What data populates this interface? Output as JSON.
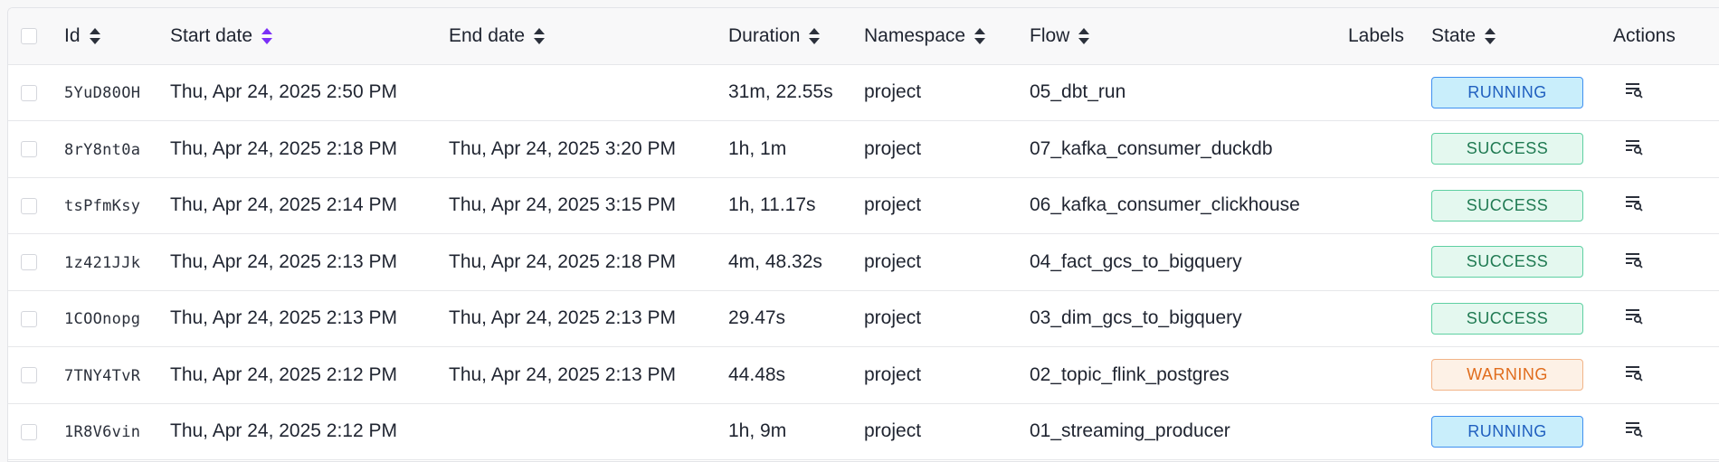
{
  "columns": {
    "id": "Id",
    "start_date": "Start date",
    "end_date": "End date",
    "duration": "Duration",
    "namespace": "Namespace",
    "flow": "Flow",
    "labels": "Labels",
    "state": "State",
    "actions": "Actions"
  },
  "sort": {
    "active_column": "start_date",
    "active_color": "#7b2ff7",
    "inactive_color": "#2b303b"
  },
  "state_colors": {
    "RUNNING": {
      "bg": "#c9eefb",
      "border": "#3f8ff0",
      "text": "#1f5fbf"
    },
    "SUCCESS": {
      "bg": "#e4f8ef",
      "border": "#5fd0a2",
      "text": "#1f7a52"
    },
    "WARNING": {
      "bg": "#fdf1e6",
      "border": "#f2b488",
      "text": "#e06c1c"
    }
  },
  "rows": [
    {
      "id": "5YuD80OH",
      "start": "Thu, Apr 24, 2025 2:50 PM",
      "end": "",
      "duration": "31m, 22.55s",
      "namespace": "project",
      "flow": "05_dbt_run",
      "labels": "",
      "state": "RUNNING",
      "action_icon": "logs-icon"
    },
    {
      "id": "8rY8nt0a",
      "start": "Thu, Apr 24, 2025 2:18 PM",
      "end": "Thu, Apr 24, 2025 3:20 PM",
      "duration": "1h, 1m",
      "namespace": "project",
      "flow": "07_kafka_consumer_duckdb",
      "labels": "",
      "state": "SUCCESS",
      "action_icon": "logs-icon"
    },
    {
      "id": "tsPfmKsy",
      "start": "Thu, Apr 24, 2025 2:14 PM",
      "end": "Thu, Apr 24, 2025 3:15 PM",
      "duration": "1h, 11.17s",
      "namespace": "project",
      "flow": "06_kafka_consumer_clickhouse",
      "labels": "",
      "state": "SUCCESS",
      "action_icon": "logs-icon"
    },
    {
      "id": "1z421JJk",
      "start": "Thu, Apr 24, 2025 2:13 PM",
      "end": "Thu, Apr 24, 2025 2:18 PM",
      "duration": "4m, 48.32s",
      "namespace": "project",
      "flow": "04_fact_gcs_to_bigquery",
      "labels": "",
      "state": "SUCCESS",
      "action_icon": "logs-icon"
    },
    {
      "id": "1COOnopg",
      "start": "Thu, Apr 24, 2025 2:13 PM",
      "end": "Thu, Apr 24, 2025 2:13 PM",
      "duration": "29.47s",
      "namespace": "project",
      "flow": "03_dim_gcs_to_bigquery",
      "labels": "",
      "state": "SUCCESS",
      "action_icon": "logs-icon"
    },
    {
      "id": "7TNY4TvR",
      "start": "Thu, Apr 24, 2025 2:12 PM",
      "end": "Thu, Apr 24, 2025 2:13 PM",
      "duration": "44.48s",
      "namespace": "project",
      "flow": "02_topic_flink_postgres",
      "labels": "",
      "state": "WARNING",
      "action_icon": "logs-icon"
    },
    {
      "id": "1R8V6vin",
      "start": "Thu, Apr 24, 2025 2:12 PM",
      "end": "",
      "duration": "1h, 9m",
      "namespace": "project",
      "flow": "01_streaming_producer",
      "labels": "",
      "state": "RUNNING",
      "action_icon": "logs-icon"
    }
  ]
}
